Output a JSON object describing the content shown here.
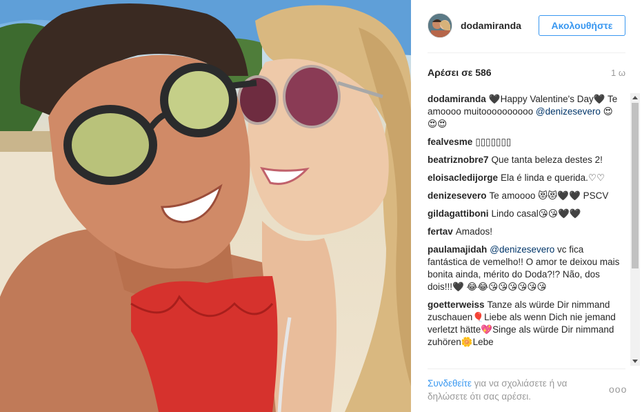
{
  "header": {
    "username": "dodamiranda",
    "follow_label": "Ακολουθήστε"
  },
  "likes_label": "Αρέσει σε 586",
  "time_label": "1 ω",
  "comments": [
    {
      "user": "dodamiranda",
      "parts": [
        {
          "text": "🖤Happy Valentine's Day🖤 Te amoooo muitoooooooooo "
        },
        {
          "text": "@denizesevero",
          "mention": true
        },
        {
          "text": " 😍😍😍"
        }
      ]
    },
    {
      "user": "fealvesme",
      "parts": [
        {
          "text": "▯▯▯▯▯▯▯"
        }
      ]
    },
    {
      "user": "beatriznobre7",
      "parts": [
        {
          "text": "Que tanta beleza destes 2!"
        }
      ]
    },
    {
      "user": "eloisacledijorge",
      "parts": [
        {
          "text": "Ela é linda e querida.♡♡"
        }
      ]
    },
    {
      "user": "denizesevero",
      "parts": [
        {
          "text": "Te amoooo 😻😻🖤🖤 PSCV"
        }
      ]
    },
    {
      "user": "gildagattiboni",
      "parts": [
        {
          "text": "Lindo casal😘😘🖤🖤"
        }
      ]
    },
    {
      "user": "fertav",
      "parts": [
        {
          "text": "Amados!"
        }
      ]
    },
    {
      "user": "paulamajidah",
      "parts": [
        {
          "text": "@denizesevero",
          "mention": true
        },
        {
          "text": " vc fica fantástica de vemelho!! O amor te deixou mais bonita ainda, mérito do Doda?!? Não, dos dois!!!🖤 😂😂😘😘😘😘😘😘"
        }
      ]
    },
    {
      "user": "goetterweiss",
      "parts": [
        {
          "text": "Tanze als würde Dir nimmand zuschauen🎈Liebe als wenn Dich nie jemand verletzt hätte💖Singe als würde Dir nimmand zuhören🌼Lebe"
        }
      ]
    }
  ],
  "footer": {
    "login_label": "Συνδεθείτε",
    "rest_label": " για να σχολιάσετε ή να δηλώσετε ότι σας αρέσει."
  },
  "more_label": "ooo",
  "colors": {
    "accent": "#3897f0",
    "mention": "#003569",
    "muted": "#999999"
  }
}
